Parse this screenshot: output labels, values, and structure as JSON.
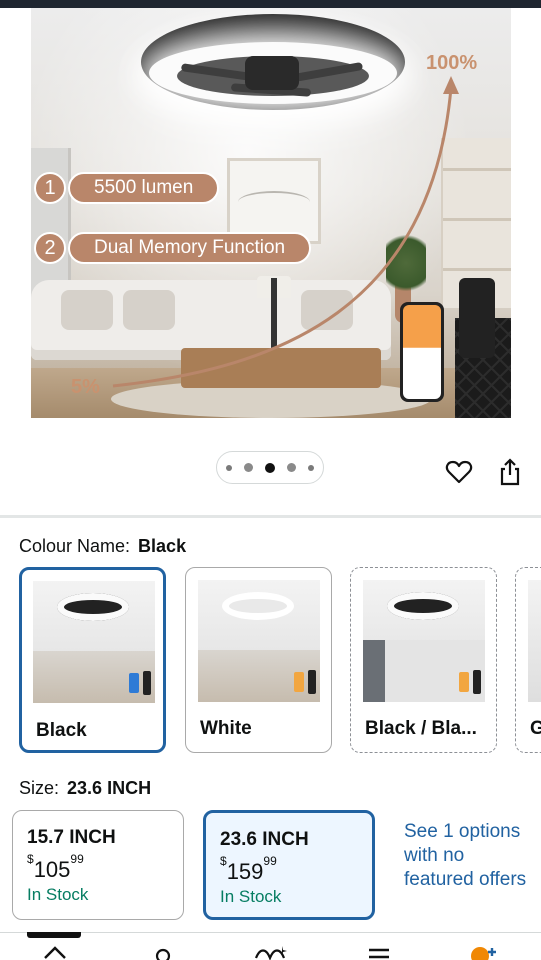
{
  "hero": {
    "callout_1_number": "1",
    "callout_1_text": "5500 lumen",
    "callout_2_number": "2",
    "callout_2_text": "Dual Memory Function",
    "brightness_max": "100%",
    "brightness_min": "5%",
    "image_count": 5,
    "active_image_index": 2
  },
  "actions": {
    "favorite_icon": "heart-icon",
    "share_icon": "share-icon"
  },
  "colour": {
    "label": "Colour Name:",
    "selected": "Black",
    "options": [
      {
        "name": "Black",
        "state": "selected"
      },
      {
        "name": "White",
        "state": "available"
      },
      {
        "name": "Black / Bla...",
        "state": "unavailable"
      },
      {
        "name": "G",
        "state": "unavailable"
      }
    ]
  },
  "size": {
    "label": "Size:",
    "selected": "23.6 INCH",
    "options": [
      {
        "name": "15.7 INCH",
        "currency": "$",
        "price_whole": "105",
        "price_fraction": "99",
        "stock": "In Stock",
        "state": "available"
      },
      {
        "name": "23.6 INCH",
        "currency": "$",
        "price_whole": "159",
        "price_fraction": "99",
        "stock": "In Stock",
        "state": "selected"
      }
    ],
    "see_options_text": "See 1 options with no featured offers"
  },
  "bottom_nav": {
    "icons": [
      "home-icon",
      "profile-icon",
      "rufus-icon",
      "menu-icon",
      "cart-icon"
    ]
  },
  "colors": {
    "accent_blue": "#2162a1",
    "in_stock_green": "#067d62",
    "callout_brown": "#b9866a"
  }
}
